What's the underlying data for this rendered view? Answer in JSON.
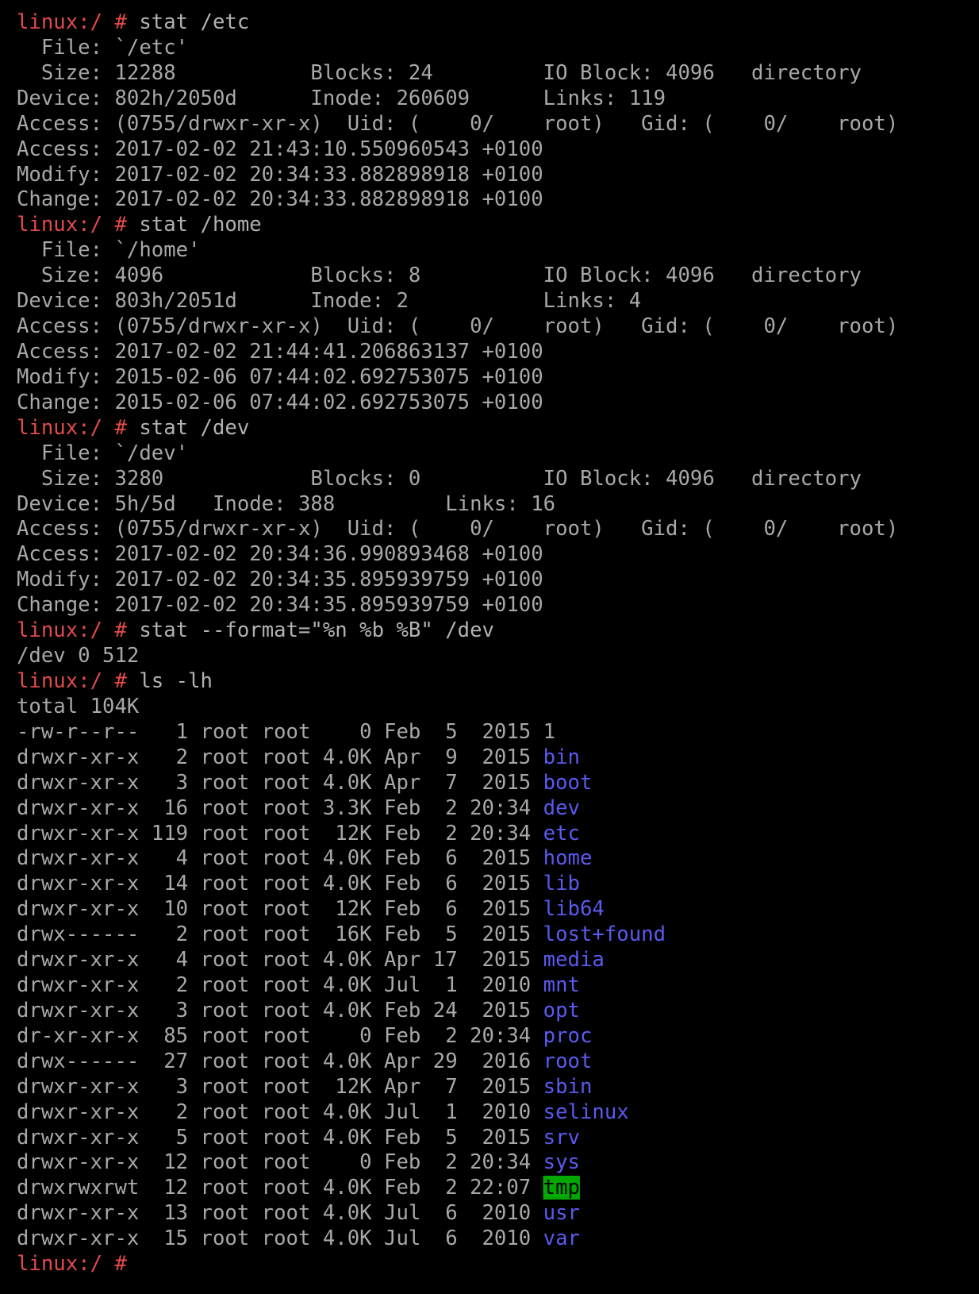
{
  "terminal": {
    "prompt": "linux:/ #",
    "colors": {
      "background": "#000000",
      "foreground": "#a8a8a8",
      "prompt": "#e24a4a",
      "directory": "#5a5af0",
      "sticky_dir_bg": "#00a800",
      "sticky_dir_fg": "#000000"
    },
    "lines": [
      {
        "type": "prompt",
        "command": "stat /etc"
      },
      {
        "type": "out",
        "text": "  File: `/etc'"
      },
      {
        "type": "out",
        "text": "  Size: 12288           Blocks: 24         IO Block: 4096   directory"
      },
      {
        "type": "out",
        "text": "Device: 802h/2050d      Inode: 260609      Links: 119"
      },
      {
        "type": "out",
        "text": "Access: (0755/drwxr-xr-x)  Uid: (    0/    root)   Gid: (    0/    root)"
      },
      {
        "type": "out",
        "text": "Access: 2017-02-02 21:43:10.550960543 +0100"
      },
      {
        "type": "out",
        "text": "Modify: 2017-02-02 20:34:33.882898918 +0100"
      },
      {
        "type": "out",
        "text": "Change: 2017-02-02 20:34:33.882898918 +0100"
      },
      {
        "type": "prompt",
        "command": "stat /home"
      },
      {
        "type": "out",
        "text": "  File: `/home'"
      },
      {
        "type": "out",
        "text": "  Size: 4096            Blocks: 8          IO Block: 4096   directory"
      },
      {
        "type": "out",
        "text": "Device: 803h/2051d      Inode: 2           Links: 4"
      },
      {
        "type": "out",
        "text": "Access: (0755/drwxr-xr-x)  Uid: (    0/    root)   Gid: (    0/    root)"
      },
      {
        "type": "out",
        "text": "Access: 2017-02-02 21:44:41.206863137 +0100"
      },
      {
        "type": "out",
        "text": "Modify: 2015-02-06 07:44:02.692753075 +0100"
      },
      {
        "type": "out",
        "text": "Change: 2015-02-06 07:44:02.692753075 +0100"
      },
      {
        "type": "prompt",
        "command": "stat /dev"
      },
      {
        "type": "out",
        "text": "  File: `/dev'"
      },
      {
        "type": "out",
        "text": "  Size: 3280            Blocks: 0          IO Block: 4096   directory"
      },
      {
        "type": "out",
        "text": "Device: 5h/5d   Inode: 388         Links: 16"
      },
      {
        "type": "out",
        "text": "Access: (0755/drwxr-xr-x)  Uid: (    0/    root)   Gid: (    0/    root)"
      },
      {
        "type": "out",
        "text": "Access: 2017-02-02 20:34:36.990893468 +0100"
      },
      {
        "type": "out",
        "text": "Modify: 2017-02-02 20:34:35.895939759 +0100"
      },
      {
        "type": "out",
        "text": "Change: 2017-02-02 20:34:35.895939759 +0100"
      },
      {
        "type": "prompt",
        "command": "stat --format=\"%n %b %B\" /dev"
      },
      {
        "type": "out",
        "text": "/dev 0 512"
      },
      {
        "type": "prompt",
        "command": "ls -lh"
      },
      {
        "type": "out",
        "text": "total 104K"
      }
    ],
    "ls_entries": [
      {
        "meta": "-rw-r--r--   1 root root    0 Feb  5  2015 ",
        "name": "1",
        "kind": "file"
      },
      {
        "meta": "drwxr-xr-x   2 root root 4.0K Apr  9  2015 ",
        "name": "bin",
        "kind": "dir"
      },
      {
        "meta": "drwxr-xr-x   3 root root 4.0K Apr  7  2015 ",
        "name": "boot",
        "kind": "dir"
      },
      {
        "meta": "drwxr-xr-x  16 root root 3.3K Feb  2 20:34 ",
        "name": "dev",
        "kind": "dir"
      },
      {
        "meta": "drwxr-xr-x 119 root root  12K Feb  2 20:34 ",
        "name": "etc",
        "kind": "dir"
      },
      {
        "meta": "drwxr-xr-x   4 root root 4.0K Feb  6  2015 ",
        "name": "home",
        "kind": "dir"
      },
      {
        "meta": "drwxr-xr-x  14 root root 4.0K Feb  6  2015 ",
        "name": "lib",
        "kind": "dir"
      },
      {
        "meta": "drwxr-xr-x  10 root root  12K Feb  6  2015 ",
        "name": "lib64",
        "kind": "dir"
      },
      {
        "meta": "drwx------   2 root root  16K Feb  5  2015 ",
        "name": "lost+found",
        "kind": "dir"
      },
      {
        "meta": "drwxr-xr-x   4 root root 4.0K Apr 17  2015 ",
        "name": "media",
        "kind": "dir"
      },
      {
        "meta": "drwxr-xr-x   2 root root 4.0K Jul  1  2010 ",
        "name": "mnt",
        "kind": "dir"
      },
      {
        "meta": "drwxr-xr-x   3 root root 4.0K Feb 24  2015 ",
        "name": "opt",
        "kind": "dir"
      },
      {
        "meta": "dr-xr-xr-x  85 root root    0 Feb  2 20:34 ",
        "name": "proc",
        "kind": "dir"
      },
      {
        "meta": "drwx------  27 root root 4.0K Apr 29  2016 ",
        "name": "root",
        "kind": "dir"
      },
      {
        "meta": "drwxr-xr-x   3 root root  12K Apr  7  2015 ",
        "name": "sbin",
        "kind": "dir"
      },
      {
        "meta": "drwxr-xr-x   2 root root 4.0K Jul  1  2010 ",
        "name": "selinux",
        "kind": "dir"
      },
      {
        "meta": "drwxr-xr-x   5 root root 4.0K Feb  5  2015 ",
        "name": "srv",
        "kind": "dir"
      },
      {
        "meta": "drwxr-xr-x  12 root root    0 Feb  2 20:34 ",
        "name": "sys",
        "kind": "dir"
      },
      {
        "meta": "drwxrwxrwt  12 root root 4.0K Feb  2 22:07 ",
        "name": "tmp",
        "kind": "sticky"
      },
      {
        "meta": "drwxr-xr-x  13 root root 4.0K Jul  6  2010 ",
        "name": "usr",
        "kind": "dir"
      },
      {
        "meta": "drwxr-xr-x  15 root root 4.0K Jul  6  2010 ",
        "name": "var",
        "kind": "dir"
      }
    ],
    "final_prompt": {
      "command": ""
    }
  }
}
